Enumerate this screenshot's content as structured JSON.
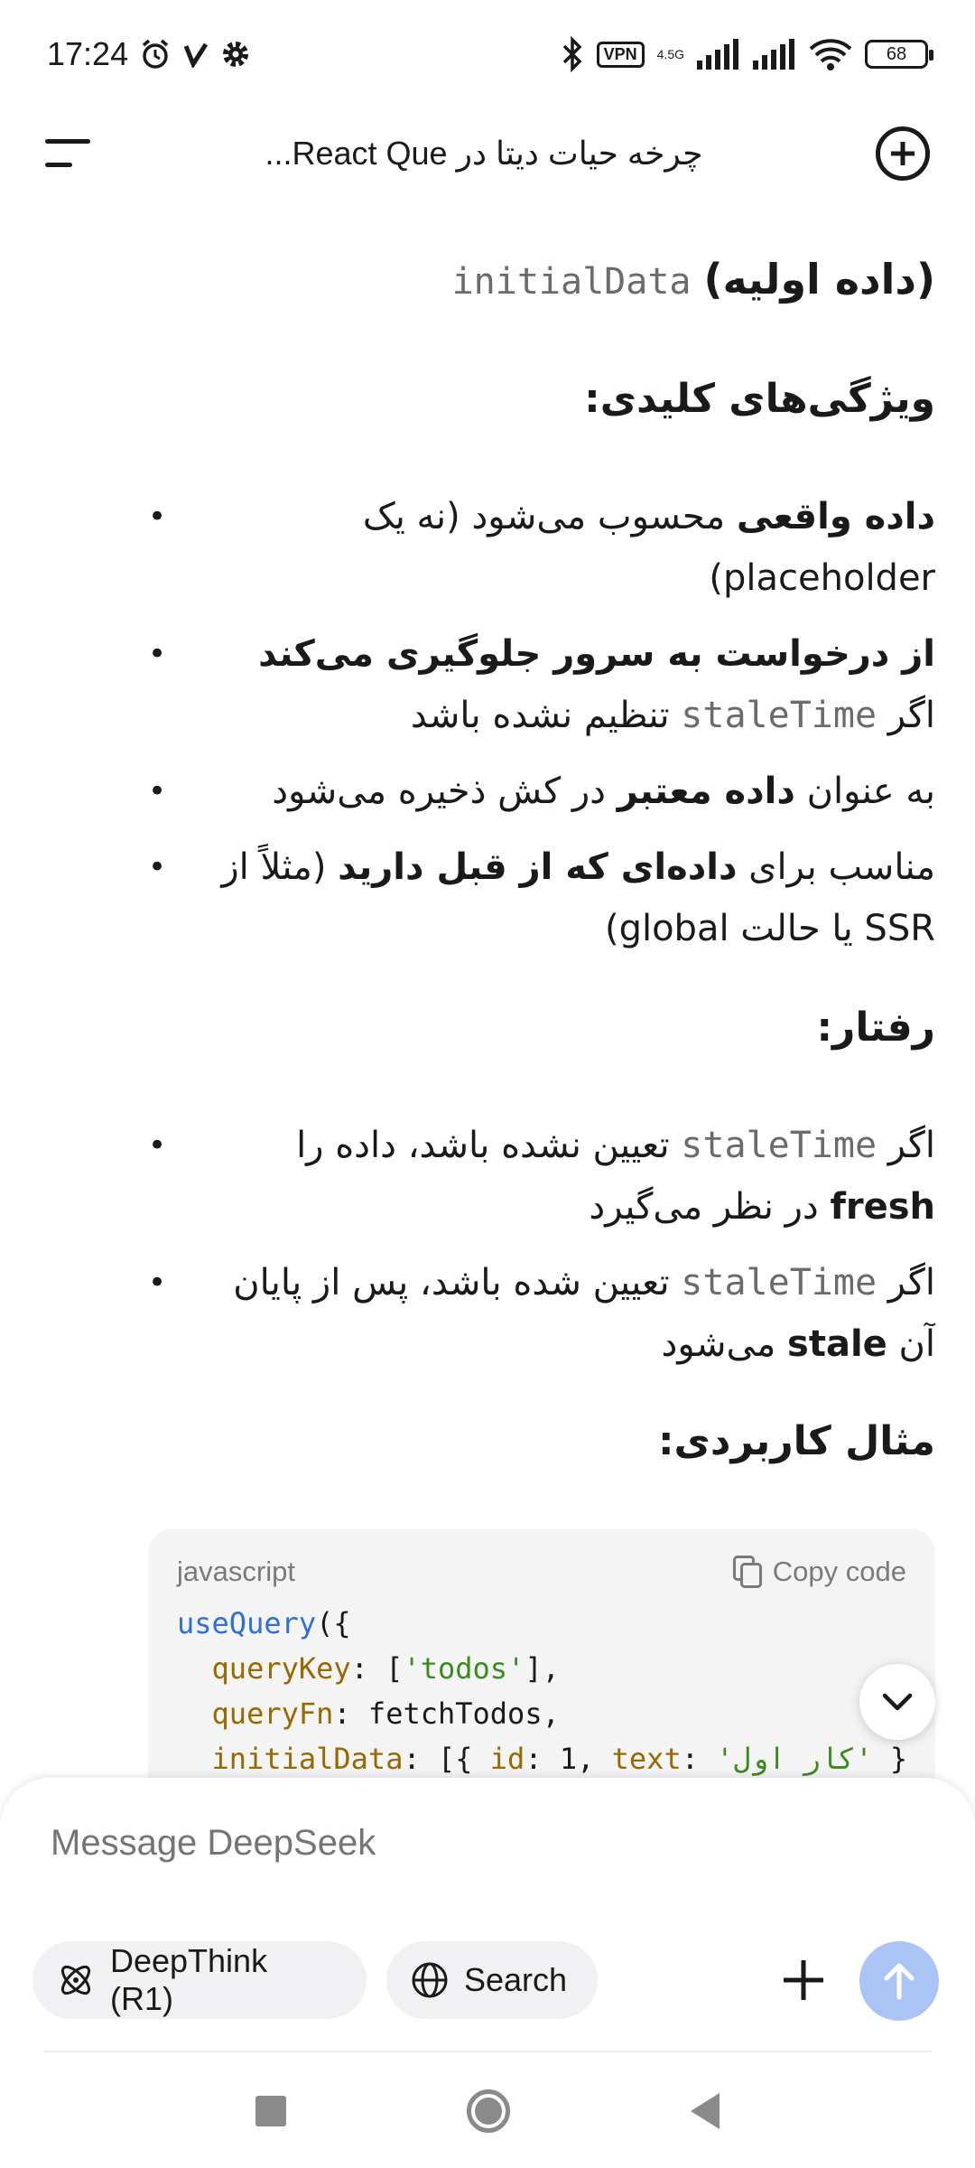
{
  "status_bar": {
    "time": "17:24",
    "vpn": "VPN",
    "network": "4.5G",
    "battery": "68"
  },
  "header": {
    "title": "چرخه حیات دیتا در React Que..."
  },
  "content": {
    "heading_code": "initialData",
    "heading_text": "(داده اولیه)",
    "features_title": "ویژگی‌های کلیدی:",
    "features": [
      {
        "b1": "داده واقعی",
        "t1": " محسوب می‌شود (نه یک placeholder)"
      },
      {
        "b1": "از درخواست به سرور جلوگیری می‌کند",
        "t1": " اگر ",
        "code": "staleTime",
        "t2": " تنظیم نشده باشد"
      },
      {
        "t0": "به عنوان ",
        "b1": "داده معتبر",
        "t1": " در کش ذخیره می‌شود"
      },
      {
        "t0": "مناسب برای ",
        "b1": "داده‌ای که از قبل دارید",
        "t1": " (مثلاً از SSR یا حالت global)"
      }
    ],
    "behavior_title": "رفتار:",
    "behaviors": [
      {
        "t0": "اگر ",
        "code": "staleTime",
        "t1": " تعیین نشده باشد، داده را ",
        "b1": "fresh",
        "t2": " در نظر می‌گیرد"
      },
      {
        "t0": "اگر ",
        "code": "staleTime",
        "t1": " تعیین شده باشد، پس از پایان آن ",
        "b1": "stale",
        "t2": " می‌شود"
      }
    ],
    "example_title": "مثال کاربردی:",
    "code_block": {
      "language": "javascript",
      "copy_label": "Copy code",
      "lines": [
        "useQuery({",
        "  queryKey: ['todos'],",
        "  queryFn: fetchTodos,",
        "  initialData: [{ id: 1, text: 'کار اول' }"
      ]
    }
  },
  "composer": {
    "placeholder": "Message DeepSeek",
    "deepthink_label": "DeepThink (R1)",
    "search_label": "Search"
  },
  "colors": {
    "send_button": "#a9c4f5",
    "code_bg": "#f4f4f5",
    "code_fn": "#2f6fd6",
    "code_prop": "#986801",
    "code_str": "#3a8b1f"
  }
}
